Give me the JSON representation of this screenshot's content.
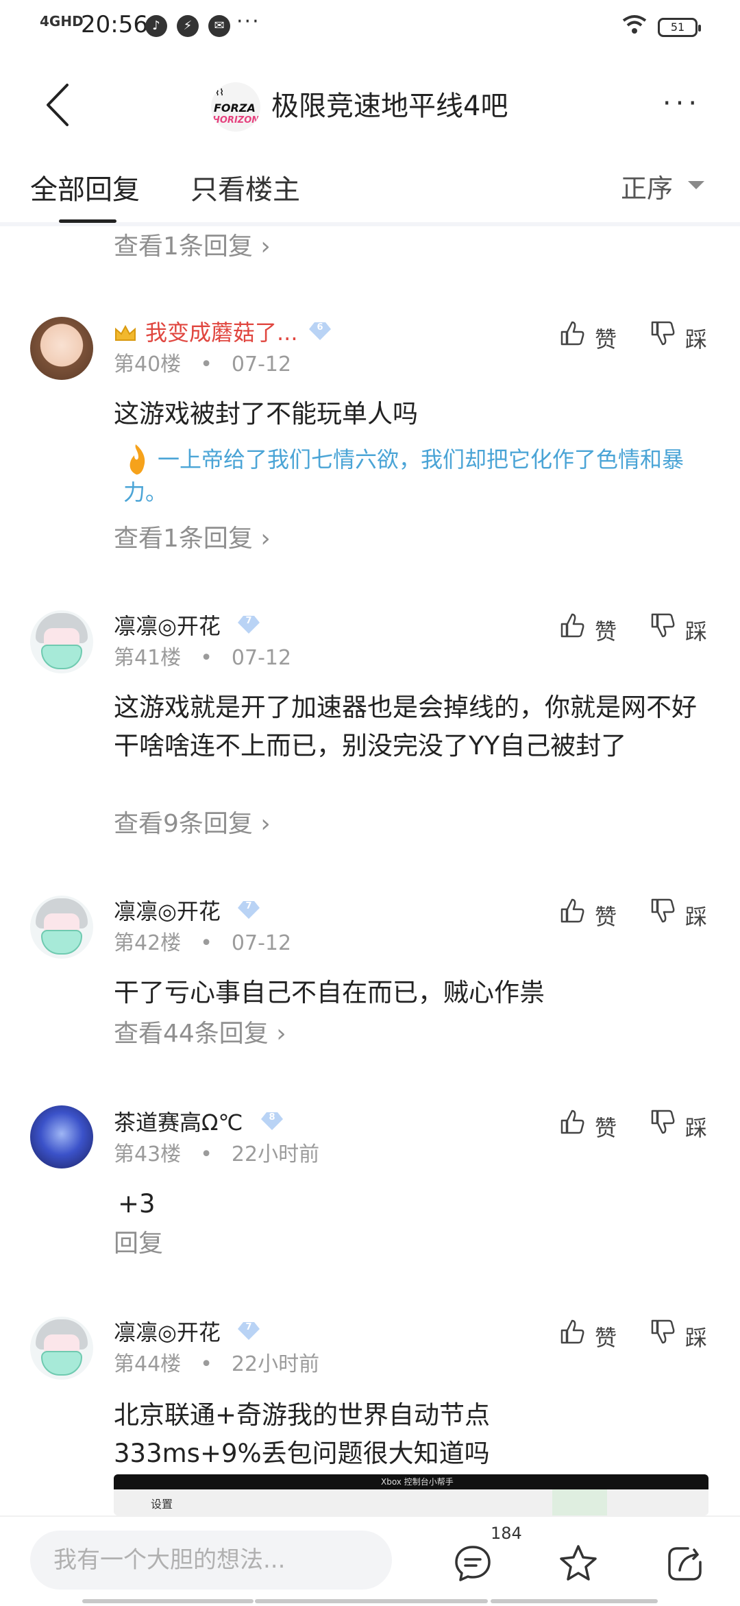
{
  "status_bar": {
    "network": "4GHD",
    "time": "20:56",
    "more": "···",
    "battery": "51"
  },
  "header": {
    "forum_logo": {
      "line1": "FORZA",
      "line2": "FORZA",
      "line3": "HORIZON 4"
    },
    "forum_name": "极限竞速地平线4吧",
    "more": "···"
  },
  "tabs": {
    "all_replies": "全部回复",
    "owner_only": "只看楼主",
    "sort": "正序"
  },
  "top_view_replies": "查看1条回复 ›",
  "actions": {
    "like": "赞",
    "dislike": "踩"
  },
  "posts": [
    {
      "username": "我变成蘑菇了...",
      "level": "6",
      "floor": "第40楼",
      "dot": "•",
      "time": "07-12",
      "text": "这游戏被封了不能玩单人吗",
      "signature": "一上帝给了我们七情六欲，我们却把它化作了色情和暴力。",
      "replies": "查看1条回复 ›"
    },
    {
      "username": "凛凛◎开花",
      "level": "7",
      "floor": "第41楼",
      "dot": "•",
      "time": "07-12",
      "text": "这游戏就是开了加速器也是会掉线的，你就是网不好干啥啥连不上而已，别没完没了YY自己被封了",
      "replies": "查看9条回复 ›"
    },
    {
      "username": "凛凛◎开花",
      "level": "7",
      "floor": "第42楼",
      "dot": "•",
      "time": "07-12",
      "text": "干了亏心事自己不自在而已，贼心作祟",
      "replies": "查看44条回复 ›"
    },
    {
      "username": "茶道赛高Ω℃",
      "level": "8",
      "floor": "第43楼",
      "dot": "•",
      "time": "22小时前",
      "text": "+3",
      "replies": "回复"
    },
    {
      "username": "凛凛◎开花",
      "level": "7",
      "floor": "第44楼",
      "dot": "•",
      "time": "22小时前",
      "text_line1": "北京联通+奇游我的世界自动节点",
      "text_line2": "333ms+9%丢包问题很大知道吗",
      "image": {
        "title": "Xbox 控制台小帮手",
        "settings": "设置"
      }
    }
  ],
  "bottom_bar": {
    "placeholder": "我有一个大胆的想法...",
    "comment_count": "184"
  },
  "colors": {
    "accent_blue": "#4aa4d6",
    "username_red": "#e0463f",
    "level_badge": "#b9d3f5",
    "meta_gray": "#9b9b9b"
  }
}
